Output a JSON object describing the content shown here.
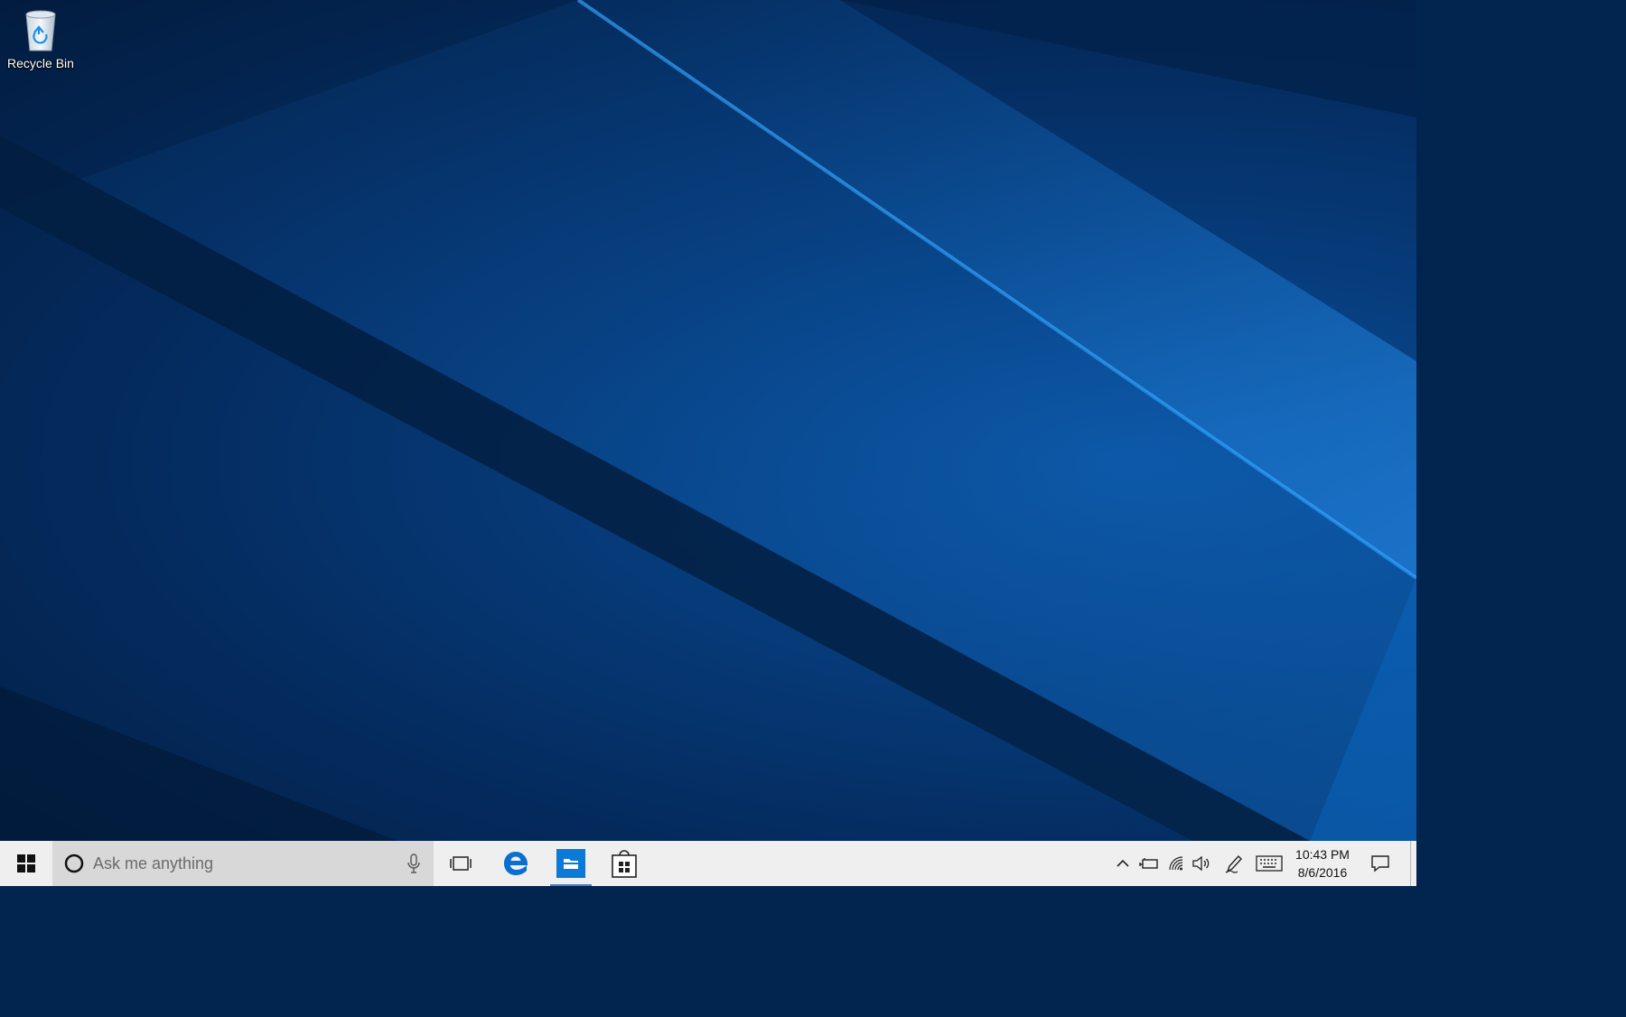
{
  "desktop": {
    "icons": [
      {
        "label": "Recycle Bin",
        "icon": "recycle-bin-icon"
      }
    ]
  },
  "taskbar": {
    "start": {
      "icon": "windows-logo-icon"
    },
    "search": {
      "placeholder": "Ask me anything",
      "icon": "cortana-circle-icon",
      "mic_icon": "microphone-icon"
    },
    "task_view": {
      "icon": "task-view-icon"
    },
    "pinned": [
      {
        "name": "Microsoft Edge",
        "icon": "edge-icon",
        "active": false
      },
      {
        "name": "File Explorer",
        "icon": "file-explorer-icon",
        "active": true
      },
      {
        "name": "Store",
        "icon": "store-icon",
        "active": false
      }
    ],
    "tray": {
      "icons": [
        "chevron-up-icon",
        "battery-icon",
        "wifi-icon",
        "volume-icon",
        "pen-ink-icon",
        "touch-keyboard-icon"
      ],
      "clock": {
        "time": "10:43 PM",
        "date": "8/6/2016"
      },
      "action_center_icon": "notification-icon"
    }
  },
  "colors": {
    "taskbar_bg": "#efefef",
    "search_bg": "#d8d8d8",
    "accent": "#0078d7"
  }
}
